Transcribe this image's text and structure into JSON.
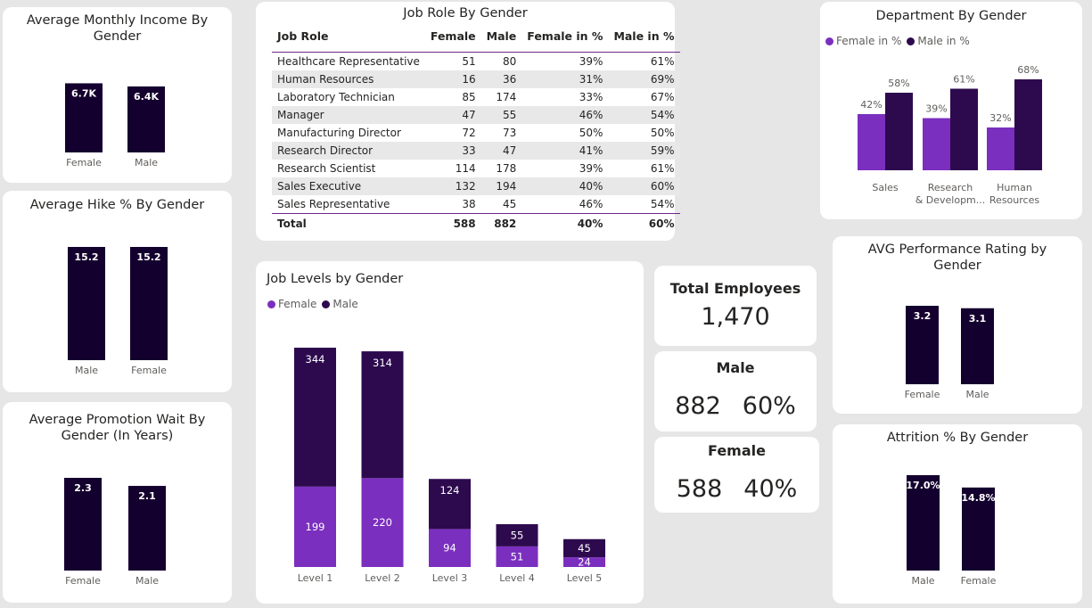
{
  "colors": {
    "female": "#7b2fbe",
    "male": "#2d0a4e",
    "bar_dark": "#14002e",
    "background": "#e6e6e6"
  },
  "income": {
    "title": "Average Monthly Income By Gender",
    "chart_data": {
      "type": "bar",
      "title": "Average Monthly Income By Gender",
      "categories": [
        "Female",
        "Male"
      ],
      "values": [
        6686,
        6381
      ],
      "data_labels": [
        "6.7K",
        "6.4K"
      ],
      "ylim": [
        0,
        7500
      ]
    }
  },
  "hike": {
    "title": "Average Hike % By Gender",
    "chart_data": {
      "type": "bar",
      "title": "Average Hike % By Gender",
      "categories": [
        "Male",
        "Female"
      ],
      "values": [
        15.2,
        15.2
      ],
      "data_labels": [
        "15.2",
        "15.2"
      ],
      "ylim": [
        0,
        15.2
      ]
    }
  },
  "promotion": {
    "title": "Average Promotion Wait By Gender (In Years)",
    "chart_data": {
      "type": "bar",
      "title": "Average Promotion Wait By Gender (In Years)",
      "categories": [
        "Female",
        "Male"
      ],
      "values": [
        2.3,
        2.1
      ],
      "data_labels": [
        "2.3",
        "2.1"
      ],
      "ylim": [
        0,
        2.3
      ]
    }
  },
  "job_role": {
    "title": "Job Role By Gender",
    "headers": [
      "Job Role",
      "Female",
      "Male",
      "Female in %",
      "Male in %"
    ],
    "rows": [
      [
        "Healthcare Representative",
        "51",
        "80",
        "39%",
        "61%"
      ],
      [
        "Human Resources",
        "16",
        "36",
        "31%",
        "69%"
      ],
      [
        "Laboratory Technician",
        "85",
        "174",
        "33%",
        "67%"
      ],
      [
        "Manager",
        "47",
        "55",
        "46%",
        "54%"
      ],
      [
        "Manufacturing Director",
        "72",
        "73",
        "50%",
        "50%"
      ],
      [
        "Research Director",
        "33",
        "47",
        "41%",
        "59%"
      ],
      [
        "Research Scientist",
        "114",
        "178",
        "39%",
        "61%"
      ],
      [
        "Sales Executive",
        "132",
        "194",
        "40%",
        "60%"
      ],
      [
        "Sales Representative",
        "38",
        "45",
        "46%",
        "54%"
      ]
    ],
    "total": [
      "Total",
      "588",
      "882",
      "40%",
      "60%"
    ]
  },
  "department": {
    "title": "Department By Gender",
    "legend": [
      "Female in %",
      "Male in %"
    ],
    "chart_data": {
      "type": "bar",
      "title": "Department By Gender",
      "categories": [
        "Sales",
        "Research & Developm...",
        "Human Resources"
      ],
      "series": [
        {
          "name": "Female in %",
          "values": [
            42,
            39,
            32
          ],
          "labels": [
            "42%",
            "39%",
            "32%"
          ]
        },
        {
          "name": "Male in %",
          "values": [
            58,
            61,
            68
          ],
          "labels": [
            "58%",
            "61%",
            "68%"
          ]
        }
      ],
      "ylim": [
        0,
        75
      ]
    }
  },
  "job_levels": {
    "title": "Job Levels by Gender",
    "legend": [
      "Female",
      "Male"
    ],
    "chart_data": {
      "type": "bar",
      "stacked": true,
      "title": "Job Levels by Gender",
      "categories": [
        "Level 1",
        "Level 2",
        "Level 3",
        "Level 4",
        "Level 5"
      ],
      "series": [
        {
          "name": "Female",
          "values": [
            199,
            220,
            94,
            51,
            24
          ]
        },
        {
          "name": "Male",
          "values": [
            344,
            314,
            124,
            55,
            45
          ]
        }
      ],
      "ylim": [
        0,
        600
      ]
    }
  },
  "kpi": {
    "total_title": "Total Employees",
    "total_value": "1,470",
    "male_title": "Male",
    "male_count": "882",
    "male_pct": "60%",
    "female_title": "Female",
    "female_count": "588",
    "female_pct": "40%"
  },
  "performance": {
    "title": "AVG Performance Rating by Gender",
    "chart_data": {
      "type": "bar",
      "title": "AVG Performance Rating by Gender",
      "categories": [
        "Female",
        "Male"
      ],
      "values": [
        3.2,
        3.1
      ],
      "data_labels": [
        "3.2",
        "3.1"
      ],
      "ylim": [
        0,
        3.2
      ]
    }
  },
  "attrition": {
    "title": "Attrition % By Gender",
    "chart_data": {
      "type": "bar",
      "title": "Attrition % By Gender",
      "categories": [
        "Male",
        "Female"
      ],
      "values": [
        17.0,
        14.8
      ],
      "data_labels": [
        "17.0%",
        "14.8%"
      ],
      "ylim": [
        0,
        17.0
      ]
    }
  }
}
